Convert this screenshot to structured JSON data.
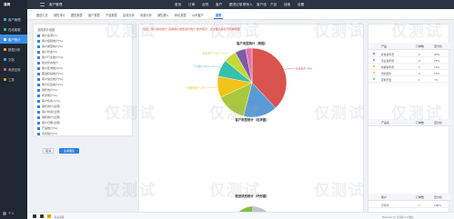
{
  "sidebar": {
    "logo": "易网",
    "items": [
      {
        "label": "客户管理",
        "active": false
      },
      {
        "label": "在线客服",
        "active": false
      },
      {
        "label": "客户统计",
        "active": true
      },
      {
        "label": "数据分析",
        "active": false
      },
      {
        "label": "文档",
        "active": false
      },
      {
        "label": "系统应用",
        "active": false
      },
      {
        "label": "工具",
        "active": false
      }
    ],
    "user": "个人"
  },
  "topbar": {
    "title": "客户管理",
    "nav": [
      "首页",
      "订单",
      "合同",
      "客户",
      "跟进记录",
      "联系人",
      "客户池",
      "产品",
      "线索",
      "设置"
    ]
  },
  "tabs": [
    "跟进汇总",
    "销售排行",
    "跟进报表",
    "客户报表",
    "产品报表",
    "区域分析",
    "来源分析",
    "销售漏斗",
    "转化报表",
    "公司客户"
  ],
  "active_tab": "报表",
  "filter": {
    "header": "选择统计维度",
    "options": [
      "客户来源(%)",
      "客户级别统计(%)",
      "客户类型统计(%)",
      "客户状态(%)",
      "客户行业统计(%)",
      "成交状态统计",
      "客户区域统计(%)",
      "跟进阶段统计(%)",
      "客户信息统计(%)",
      "客户标签统计(%)",
      "销售统计(%)",
      "成交统计(%)",
      "客户负责人(%)",
      "销售排行(全部)",
      "客户时间(全部)",
      "销售统计(全部)",
      "客户归属(全部)",
      "产品统计(%)",
      "合同统计(%)"
    ],
    "cancel": "取消",
    "generate": "生成图表"
  },
  "center": {
    "breadcrumb": "当前：客户报表统计  选择客户类型进行统计  操作提示：点击图表扇区可查看明细",
    "chart1_title": "客户类型统计（饼图）",
    "chart2_title": "客户类型统计（柱状图）",
    "chart3_title": "跟进状态统计（环形图）"
  },
  "chart_data": {
    "type": "pie",
    "title": "客户类型统计（饼图）",
    "categories": [
      "企业客户",
      "代理商客户",
      "个人客户",
      "渠道客户",
      "政府客户",
      "VIP客户",
      "潜在客户",
      "其他"
    ],
    "values": [
      38,
      16,
      14,
      10,
      8,
      6,
      5,
      3
    ],
    "colors": [
      "#d9534f",
      "#5b9bd5",
      "#a8c93b",
      "#f0c419",
      "#36c1a8",
      "#c6d83a",
      "#7b5ea7",
      "#e86fb0"
    ],
    "labels": [
      "企业客户 38%",
      "",
      "",
      "代理商客户 16%",
      "个人客户 14%",
      "渠道客户 10%",
      "",
      "潜在客户 5%"
    ]
  },
  "right_table": {
    "header": [
      "产品",
      "订单数",
      "百分比"
    ],
    "rows": [
      {
        "name": "标准版年费",
        "count": "6",
        "pct": "40%",
        "color": "#d9534f"
      },
      {
        "name": "专业版年费",
        "count": "4",
        "pct": "27%",
        "color": "#5b9bd5"
      },
      {
        "name": "旗舰版年费",
        "count": "2",
        "pct": "13%",
        "color": "#a8c93b"
      },
      {
        "name": "增值服务",
        "count": "2",
        "pct": "13%",
        "color": "#f0c419"
      },
      {
        "name": "定制开发",
        "count": "1",
        "pct": "7%",
        "color": "#36c1a8"
      }
    ],
    "header2": [
      "产品名",
      "订单数",
      "百分比"
    ],
    "header3": [
      "客户",
      "订单数",
      "百分比"
    ],
    "bottom_row": {
      "name": "已签约",
      "count": "1",
      "pct": "100%"
    }
  },
  "footer": {
    "left": "联系客服",
    "right": "Powered by 企业版 2.0 微信"
  },
  "watermark": "仅测试"
}
